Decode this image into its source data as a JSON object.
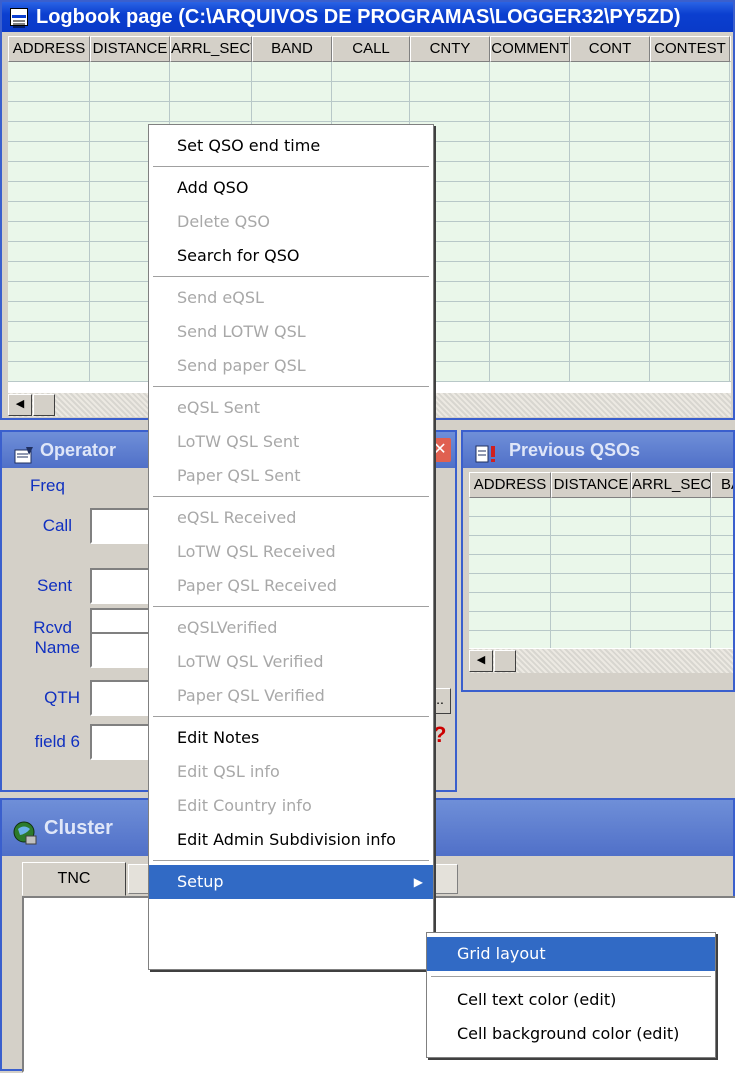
{
  "logbook": {
    "title": "Logbook page (C:\\ARQUIVOS DE PROGRAMAS\\LOGGER32\\PY5ZD)",
    "columns": [
      "ADDRESS",
      "DISTANCE",
      "ARRL_SECT",
      "BAND",
      "CALL",
      "CNTY",
      "COMMENT",
      "CONT",
      "CONTEST"
    ]
  },
  "operator": {
    "title": "Operator",
    "freq_label": "Freq",
    "fields": [
      "Call",
      "Sent",
      "Rcvd",
      "Name",
      "QTH",
      "field 6"
    ],
    "ellipsis": "..",
    "help": "?"
  },
  "previous": {
    "title": "Previous QSOs",
    "columns": [
      "ADDRESS",
      "DISTANCE",
      "ARRL_SECT",
      "BA"
    ]
  },
  "cluster": {
    "title": "Cluster",
    "tab": "TNC"
  },
  "context_menu": {
    "items": [
      {
        "label": "Set QSO end time",
        "enabled": true
      },
      {
        "label": "Add QSO",
        "enabled": true
      },
      {
        "label": "Delete QSO",
        "enabled": false
      },
      {
        "label": "Search for QSO",
        "enabled": true
      },
      {
        "label": "Send eQSL",
        "enabled": false
      },
      {
        "label": "Send LOTW QSL",
        "enabled": false
      },
      {
        "label": "Send paper QSL",
        "enabled": false
      },
      {
        "label": "eQSL Sent",
        "enabled": false
      },
      {
        "label": "LoTW QSL Sent",
        "enabled": false
      },
      {
        "label": "Paper QSL Sent",
        "enabled": false
      },
      {
        "label": "eQSL Received",
        "enabled": false
      },
      {
        "label": "LoTW QSL Received",
        "enabled": false
      },
      {
        "label": "Paper QSL Received",
        "enabled": false
      },
      {
        "label": "eQSLVerified",
        "enabled": false
      },
      {
        "label": "LoTW QSL Verified",
        "enabled": false
      },
      {
        "label": "Paper QSL Verified",
        "enabled": false
      },
      {
        "label": "Edit Notes",
        "enabled": true
      },
      {
        "label": "Edit QSL info",
        "enabled": false
      },
      {
        "label": "Edit Country info",
        "enabled": false
      },
      {
        "label": "Edit Admin Subdivision info",
        "enabled": true
      },
      {
        "label": "Setup",
        "enabled": true,
        "highlighted": true
      }
    ]
  },
  "submenu": {
    "items": [
      {
        "label": "Grid layout",
        "highlighted": true
      },
      {
        "label": "Cell text color (edit)"
      },
      {
        "label": "Cell background color (edit)"
      }
    ]
  },
  "colors": {
    "title_bar": "#0b3fd0",
    "menu_highlight": "#316ac5",
    "grid_cell": "#eaf7ea",
    "label_blue": "#1030c0"
  }
}
